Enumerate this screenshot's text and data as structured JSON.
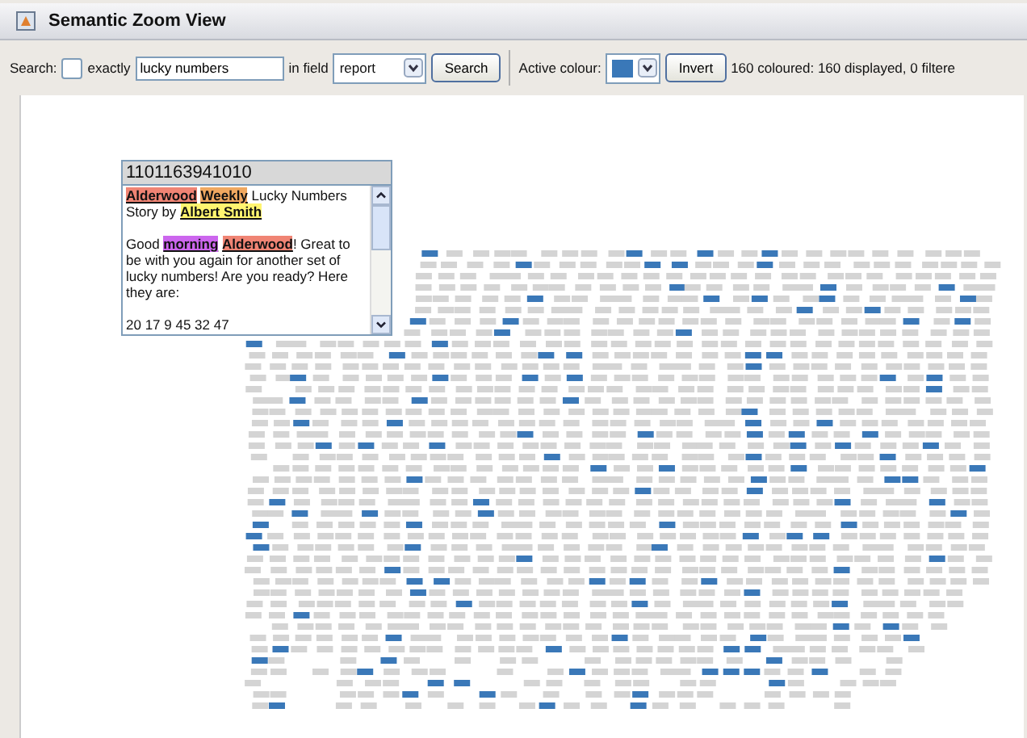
{
  "window": {
    "title": "Semantic Zoom View"
  },
  "toolbar": {
    "search_label": "Search:",
    "exactly": {
      "label": "exactly",
      "checked": false
    },
    "search_value": "lucky numbers",
    "field_label": "in field",
    "field_value": "report",
    "search_button": "Search",
    "colour_label": "Active colour:",
    "invert_button": "Invert",
    "status": "160 coloured: 160 displayed, 0 filtere"
  },
  "popup": {
    "id": "1101163941010",
    "paragraphs": [
      [
        {
          "text": "Alderwood",
          "color": "#f08474",
          "space_after": true
        },
        {
          "text": "Weekly",
          "color": "#f0a860"
        },
        {
          "text": " Lucky Numbers Story by "
        },
        {
          "text": "Albert Smith",
          "color": "#fff570"
        }
      ],
      [
        {
          "text": "Good "
        },
        {
          "text": "morning",
          "color": "#cc66ee",
          "space_after": true
        },
        {
          "text": "Alderwood",
          "color": "#f08474"
        },
        {
          "text": "!  Great to be with you again for another set of lucky numbers!  Are you ready?  Here they are:"
        }
      ],
      [
        {
          "text": "20 17 9 45 32 47"
        }
      ]
    ]
  }
}
